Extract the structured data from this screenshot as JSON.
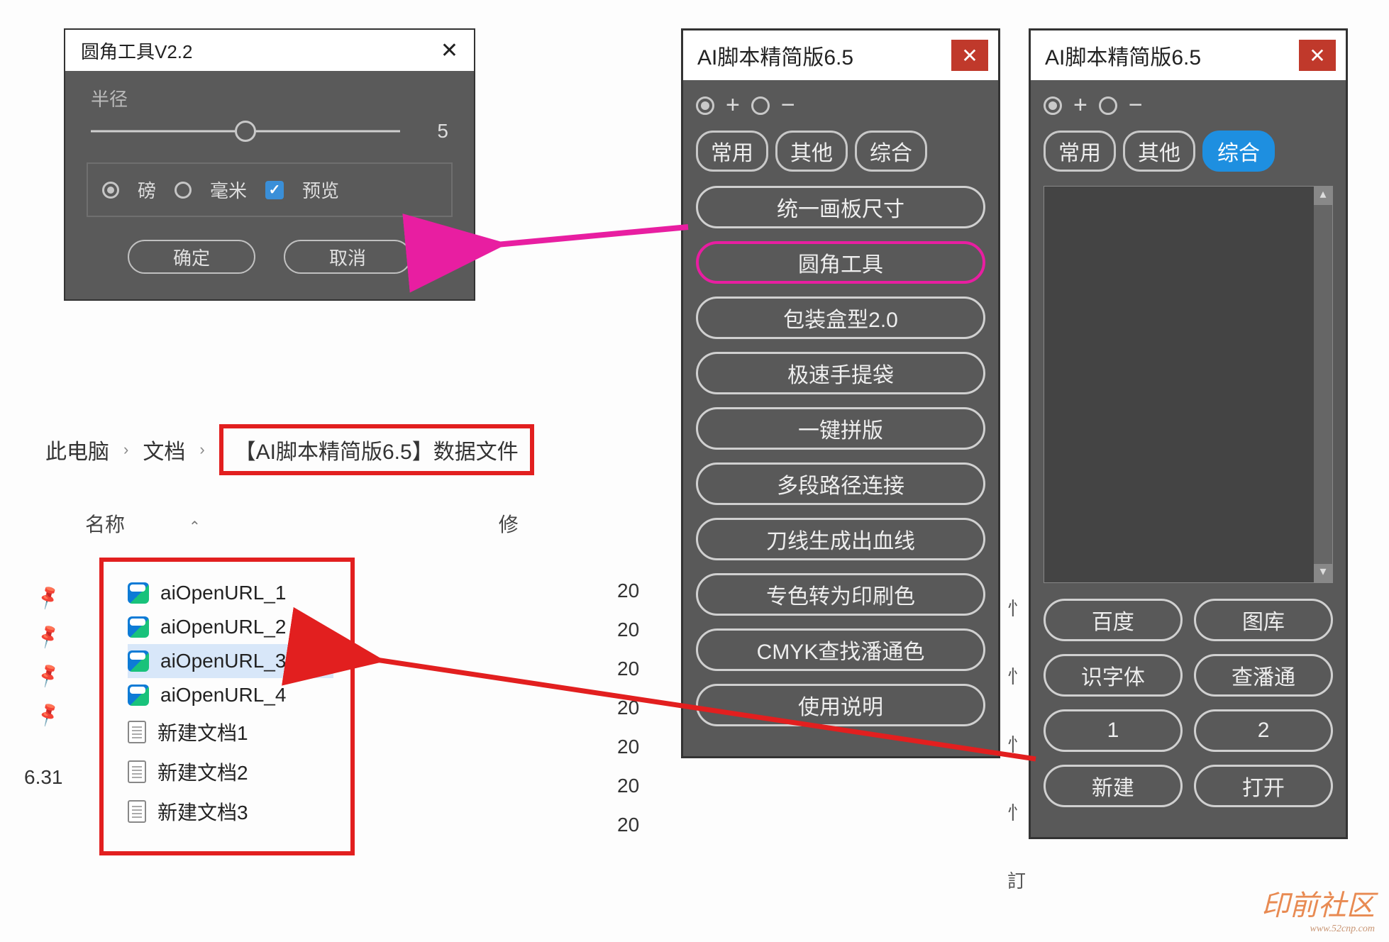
{
  "dialog": {
    "title": "圆角工具V2.2",
    "radius_label": "半径",
    "radius_value": "5",
    "unit_pound": "磅",
    "unit_mm": "毫米",
    "preview": "预览",
    "ok": "确定",
    "cancel": "取消"
  },
  "explorer": {
    "root": "此电脑",
    "folder1": "文档",
    "folder2": "【AI脚本精简版6.5】数据文件",
    "col_name": "名称",
    "col_mod": "修",
    "files": [
      {
        "name": "aiOpenURL_1",
        "kind": "url",
        "date": "20"
      },
      {
        "name": "aiOpenURL_2",
        "kind": "url",
        "date": "20"
      },
      {
        "name": "aiOpenURL_3",
        "kind": "url",
        "date": "20",
        "selected": true
      },
      {
        "name": "aiOpenURL_4",
        "kind": "url",
        "date": "20"
      },
      {
        "name": "新建文档1",
        "kind": "doc",
        "date": "20"
      },
      {
        "name": "新建文档2",
        "kind": "doc",
        "date": "20"
      },
      {
        "name": "新建文档3",
        "kind": "doc",
        "date": "20"
      }
    ],
    "outside_text": "6.31"
  },
  "panel1": {
    "title": "AI脚本精简版6.5",
    "tabs": {
      "a": "常用",
      "b": "其他",
      "c": "综合"
    },
    "buttons": [
      "统一画板尺寸",
      "圆角工具",
      "包装盒型2.0",
      "极速手提袋",
      "一键拼版",
      "多段路径连接",
      "刀线生成出血线",
      "专色转为印刷色",
      "CMYK查找潘通色",
      "使用说明"
    ]
  },
  "panel2": {
    "title": "AI脚本精简版6.5",
    "tabs": {
      "a": "常用",
      "b": "其他",
      "c": "综合"
    },
    "grid": [
      "百度",
      "图库",
      "识字体",
      "查潘通",
      "1",
      "2",
      "新建",
      "打开"
    ]
  },
  "sidechars": [
    "忄",
    "忄",
    "忄",
    "忄",
    "訂"
  ],
  "watermark": {
    "big": "印前社区",
    "small": "www.52cnp.com"
  }
}
